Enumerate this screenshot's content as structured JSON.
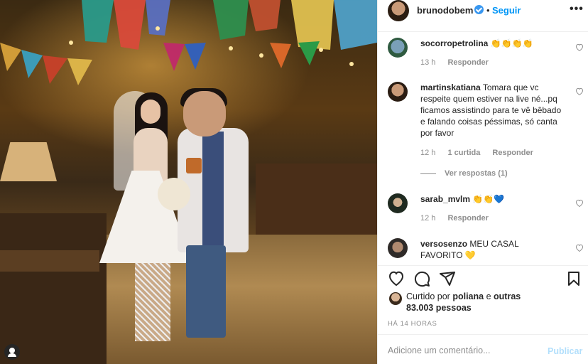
{
  "post_header": {
    "username": "brunodobem",
    "separator": "•",
    "follow_label": "Seguir",
    "more_label": "•••"
  },
  "comments": [
    {
      "username": "socorropetrolina",
      "text": "👏👏👏👏",
      "time": "13 h",
      "likes": "",
      "reply_label": "Responder"
    },
    {
      "username": "martinskatiana",
      "text": "Tomara que vc respeite quem estiver na live né...pq ficamos assistindo para te vê bêbado e falando coisas péssimas, só canta por favor",
      "time": "12 h",
      "likes": "1 curtida",
      "reply_label": "Responder",
      "view_replies": "Ver respostas (1)"
    },
    {
      "username": "sarab_mvlm",
      "text": "👏👏💙",
      "time": "12 h",
      "likes": "",
      "reply_label": "Responder"
    },
    {
      "username": "versosenzo",
      "text": "MEU CASAL FAVORITO 💛",
      "time": "",
      "likes": "",
      "reply_label": ""
    }
  ],
  "likes": {
    "prefix": "Curtido por",
    "user": "poliana",
    "connector": "e",
    "others": "outras 83.003 pessoas"
  },
  "timestamp": "HÁ 14 HORAS",
  "add_comment": {
    "placeholder": "Adicione um comentário...",
    "publish_label": "Publicar"
  },
  "colors": {
    "accent": "#0095f6",
    "verified": "#3897f0",
    "muted": "#8e8e8e",
    "publish_disabled": "#b2dffc"
  },
  "icons": [
    "verified-badge-icon",
    "more-options-icon",
    "heart-icon",
    "comment-icon",
    "share-icon",
    "bookmark-icon",
    "user-tag-icon"
  ]
}
